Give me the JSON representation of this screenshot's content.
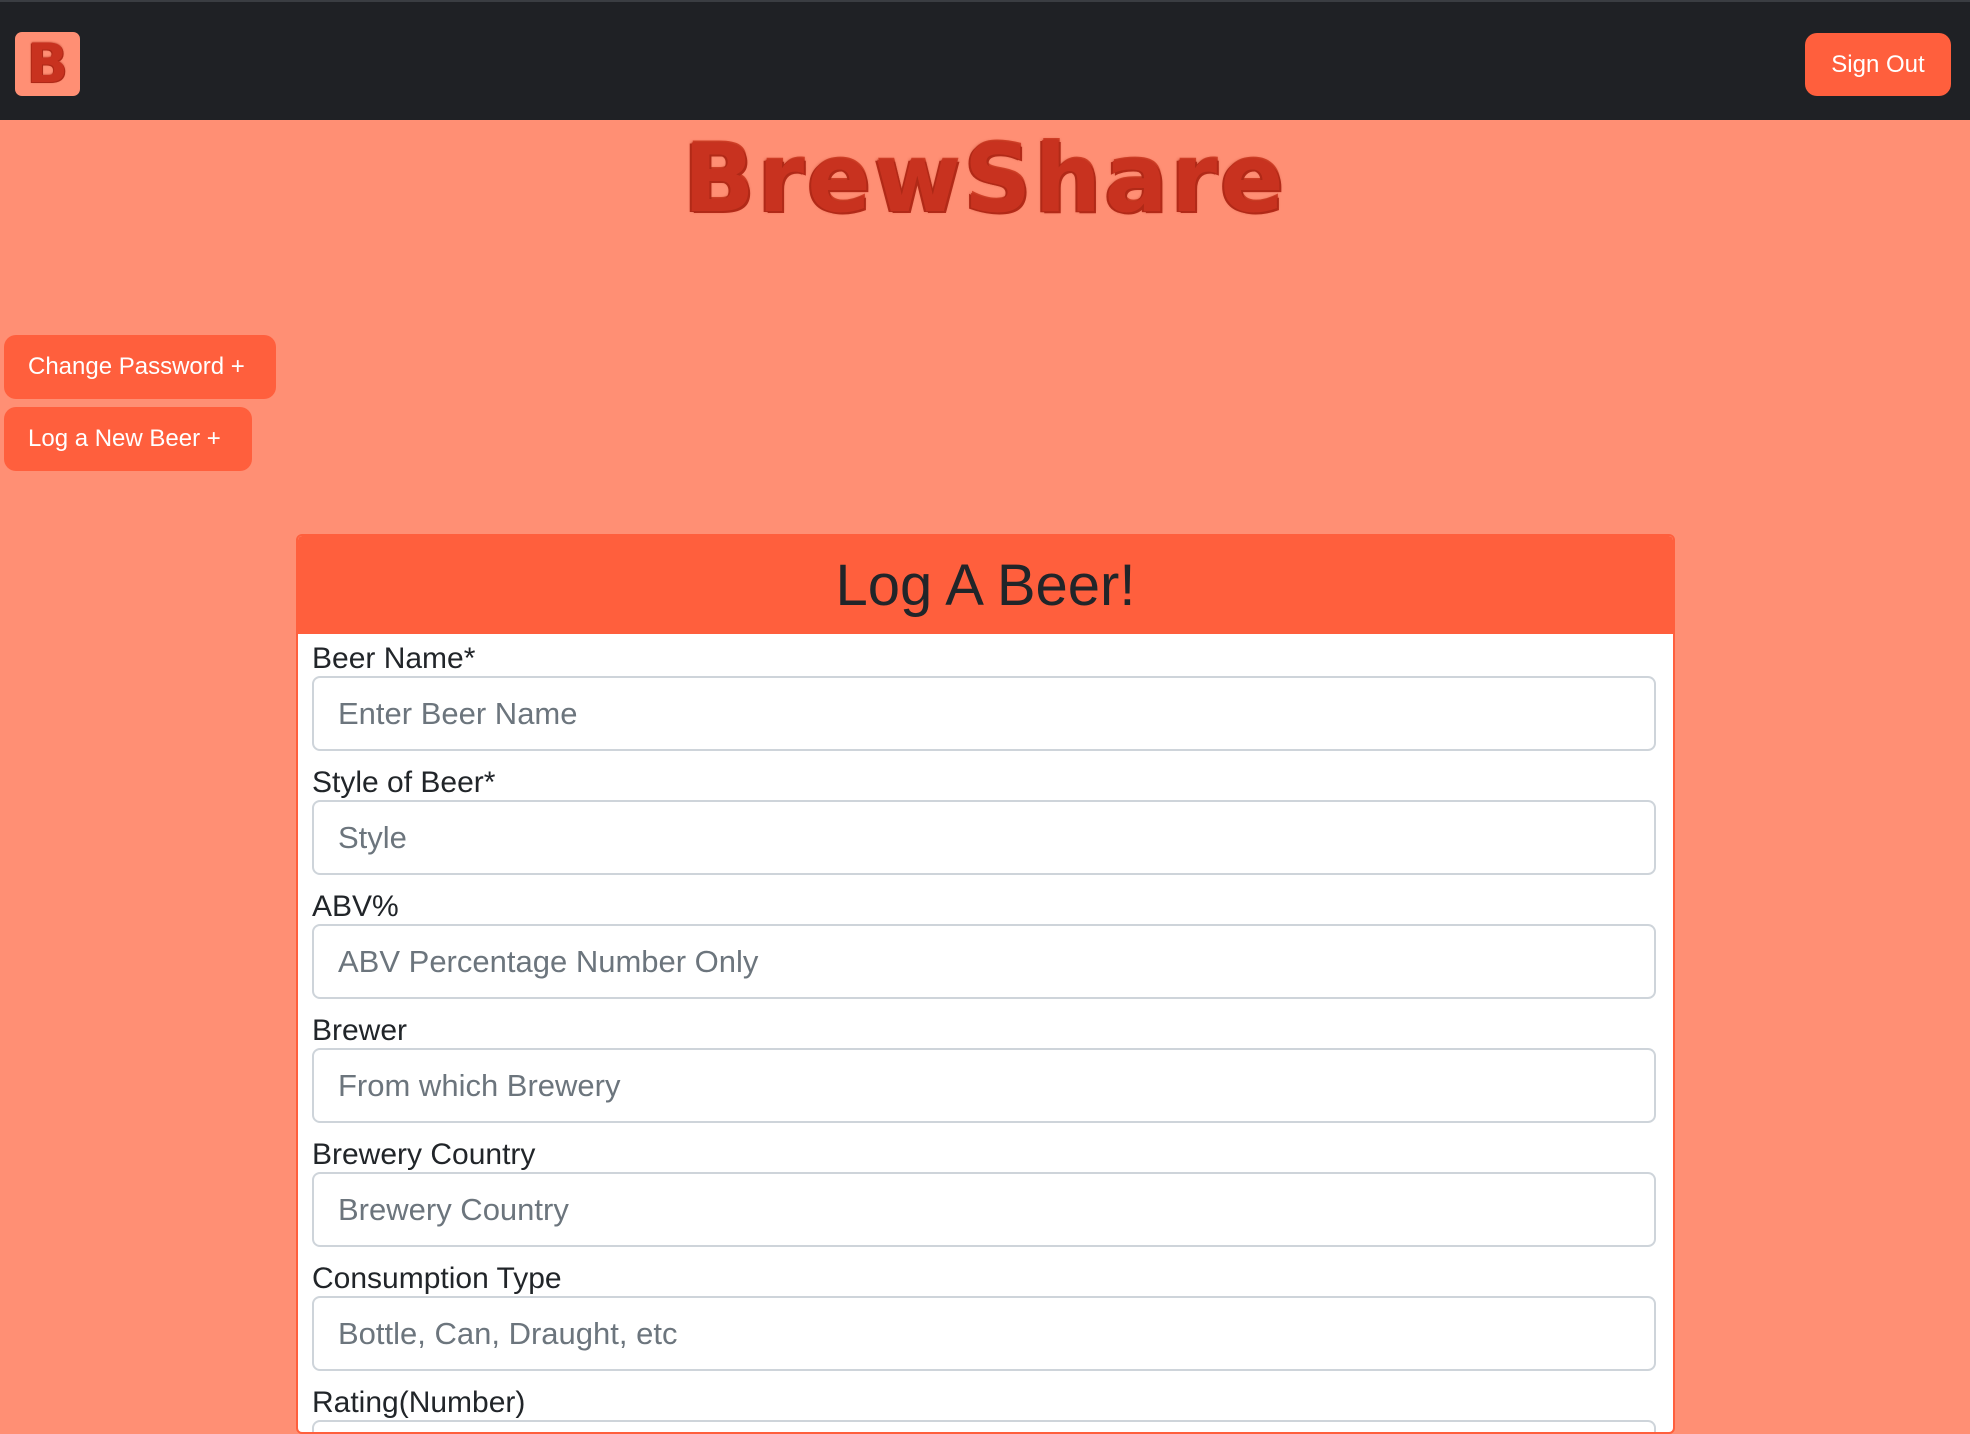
{
  "navbar": {
    "logo_letter": "B",
    "sign_out_label": "Sign Out"
  },
  "brand": {
    "title": "BrewShare"
  },
  "sidebar": {
    "change_password_label": "Change Password +",
    "log_new_beer_label": "Log a New Beer +"
  },
  "form": {
    "heading": "Log A Beer!",
    "fields": [
      {
        "label": "Beer Name*",
        "placeholder": "Enter Beer Name",
        "value": ""
      },
      {
        "label": "Style of Beer*",
        "placeholder": "Style",
        "value": ""
      },
      {
        "label": "ABV%",
        "placeholder": "ABV Percentage Number Only",
        "value": ""
      },
      {
        "label": "Brewer",
        "placeholder": "From which Brewery",
        "value": ""
      },
      {
        "label": "Brewery Country",
        "placeholder": "Brewery Country",
        "value": ""
      },
      {
        "label": "Consumption Type",
        "placeholder": "Bottle, Can, Draught, etc",
        "value": ""
      },
      {
        "label": "Rating(Number)",
        "placeholder": "",
        "value": ""
      }
    ]
  },
  "colors": {
    "page_background": "#ff8f74",
    "navbar_background": "#1f2125",
    "accent": "#ff5f3d",
    "logo_red": "#c8321f"
  }
}
